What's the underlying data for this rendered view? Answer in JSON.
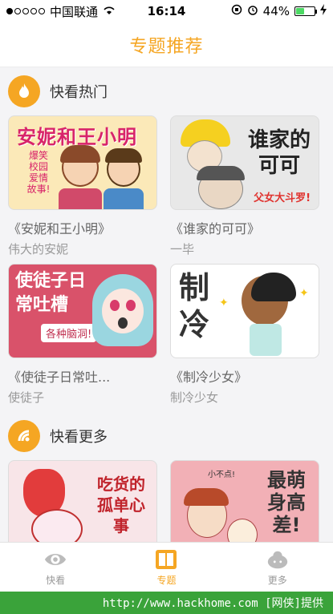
{
  "status": {
    "carrier": "中国联通",
    "time": "16:14",
    "battery": "44%",
    "battery_level": 0.44
  },
  "nav": {
    "title": "专题推荐"
  },
  "sections": [
    {
      "title": "快看热门",
      "items": [
        {
          "name": "《安妮和王小明》",
          "author": "伟大的安妮",
          "art_title": "安妮和王小明",
          "art_tag": "爆笑校园爱情故事!"
        },
        {
          "name": "《谁家的可可》",
          "author": "一毕",
          "art_title": "谁家的可可",
          "art_sub": "父女大斗罗!"
        },
        {
          "name": "《使徒子日常吐...",
          "author": "使徒子",
          "art_title": "使徒子日常吐槽",
          "art_sub": "各种脑洞!"
        },
        {
          "name": "《制冷少女》",
          "author": "制冷少女",
          "art_title": "制冷"
        }
      ]
    },
    {
      "title": "快看更多",
      "items": [
        {
          "art_title": "吃货的孤单心事"
        },
        {
          "art_title": "最萌身高差!",
          "art_sub": "小不点!"
        }
      ]
    }
  ],
  "tabs": [
    {
      "label": "快看",
      "icon": "eye-icon",
      "active": false
    },
    {
      "label": "专题",
      "icon": "book-icon",
      "active": true
    },
    {
      "label": "更多",
      "icon": "cloud-icon",
      "active": false
    }
  ],
  "watermark": "http://www.hackhome.com [网侠]提供",
  "colors": {
    "accent": "#f5a623",
    "watermark_bg": "#3aa33a"
  }
}
